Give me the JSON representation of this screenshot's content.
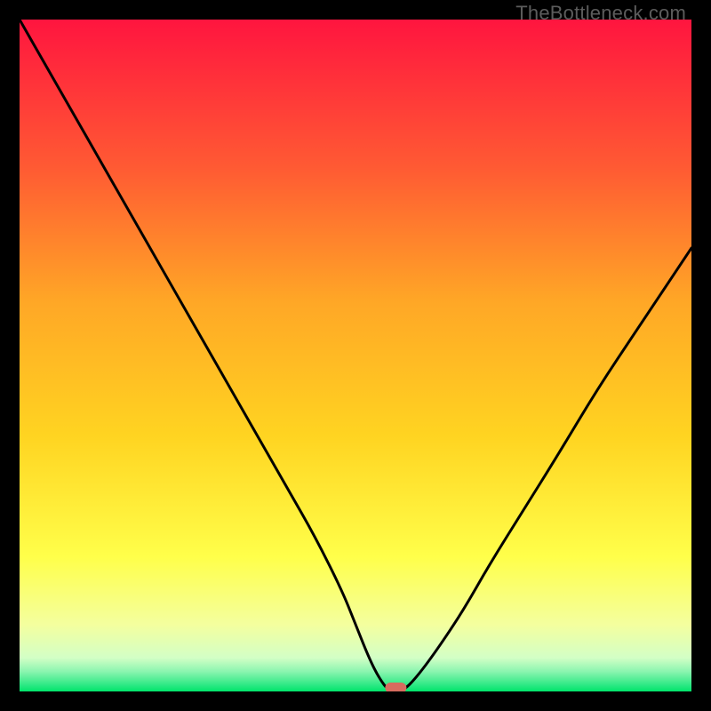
{
  "watermark": "TheBottleneck.com",
  "chart_data": {
    "type": "line",
    "title": "",
    "xlabel": "",
    "ylabel": "",
    "xlim": [
      0,
      100
    ],
    "ylim": [
      0,
      100
    ],
    "grid": false,
    "colors": {
      "gradient_top": "#ff153f",
      "gradient_mid_upper": "#ff7e2f",
      "gradient_mid": "#ffd421",
      "gradient_mid_lower": "#ffff4a",
      "gradient_lower": "#f4ff9e",
      "gradient_bottom": "#00e46b",
      "line": "#000000",
      "marker": "#d76b5e"
    },
    "series": [
      {
        "name": "bottleneck-curve",
        "x": [
          0,
          4,
          8,
          12,
          16,
          20,
          24,
          28,
          32,
          36,
          40,
          44,
          48,
          50,
          52,
          53.5,
          55,
          57,
          59,
          62,
          66,
          70,
          75,
          80,
          86,
          92,
          100
        ],
        "y": [
          100,
          93,
          86,
          79,
          72,
          65,
          58,
          51,
          44,
          37,
          30,
          23,
          15,
          10,
          5,
          2,
          0,
          0,
          2,
          6,
          12,
          19,
          27,
          35,
          45,
          54,
          66
        ]
      }
    ],
    "marker": {
      "name": "optimal-point",
      "x": 56,
      "y": 0,
      "shape": "rounded-rect",
      "color": "#d76b5e"
    }
  }
}
